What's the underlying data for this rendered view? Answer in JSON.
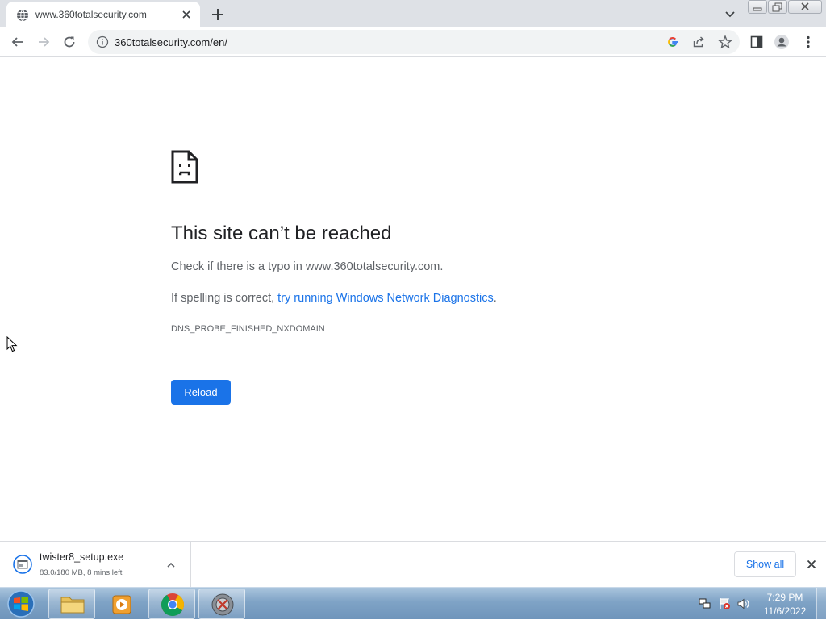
{
  "browser": {
    "tab": {
      "title": "www.360totalsecurity.com",
      "favicon": "globe-icon"
    },
    "address_bar": {
      "url": "360totalsecurity.com/en/"
    }
  },
  "error_page": {
    "icon": "sad-file-icon",
    "title": "This site can’t be reached",
    "line1": "Check if there is a typo in www.360totalsecurity.com.",
    "line2_prefix": "If spelling is correct, ",
    "line2_link": "try running Windows Network Diagnostics",
    "line2_suffix": ".",
    "error_code": "DNS_PROBE_FINISHED_NXDOMAIN",
    "reload_label": "Reload"
  },
  "download_shelf": {
    "file_name": "twister8_setup.exe",
    "status": "83.0/180 MB, 8 mins left",
    "show_all_label": "Show all"
  },
  "taskbar": {
    "time": "7:29 PM",
    "date": "11/6/2022"
  },
  "colors": {
    "accent": "#1a73e8",
    "tab_strip": "#dee1e6",
    "omnibox": "#f1f3f4",
    "text_primary": "#202124",
    "text_secondary": "#5f6368"
  }
}
